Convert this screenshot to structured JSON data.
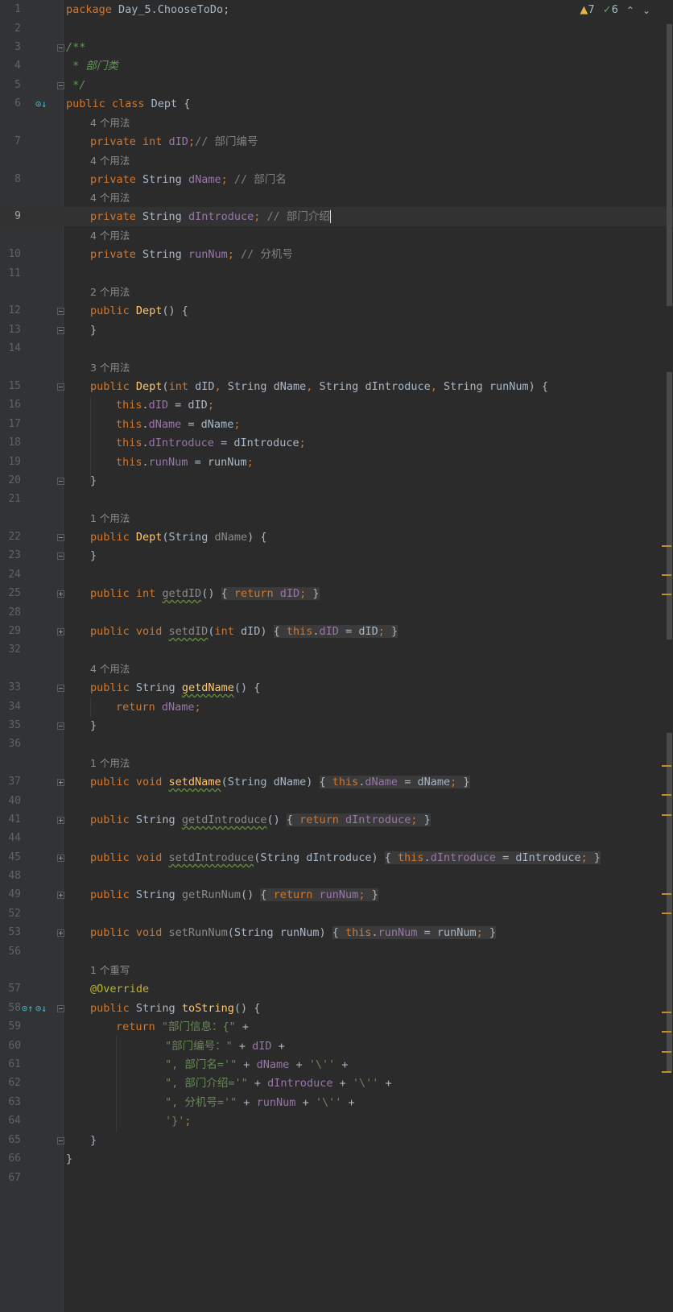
{
  "inspection": {
    "warnings": "7",
    "weak_warnings": "6"
  },
  "lines": {
    "l1": "1",
    "l2": "2",
    "l3": "3",
    "l4": "4",
    "l5": "5",
    "l6": "6",
    "l7": "7",
    "l8": "8",
    "l9": "9",
    "l10": "10",
    "l11": "11",
    "l12": "12",
    "l13": "13",
    "l14": "14",
    "l15": "15",
    "l16": "16",
    "l17": "17",
    "l18": "18",
    "l19": "19",
    "l20": "20",
    "l21": "21",
    "l22": "22",
    "l23": "23",
    "l24": "24",
    "l25": "25",
    "l28": "28",
    "l29": "29",
    "l32": "32",
    "l33": "33",
    "l34": "34",
    "l35": "35",
    "l36": "36",
    "l37": "37",
    "l40": "40",
    "l41": "41",
    "l44": "44",
    "l45": "45",
    "l48": "48",
    "l49": "49",
    "l52": "52",
    "l53": "53",
    "l56": "56",
    "l57": "57",
    "l58": "58",
    "l59": "59",
    "l60": "60",
    "l61": "61",
    "l62": "62",
    "l63": "63",
    "l64": "64",
    "l65": "65",
    "l66": "66",
    "l67": "67"
  },
  "hints": {
    "dID": "4 个用法",
    "dName": "4 个用法",
    "dIntroduce": "4 个用法",
    "runNum": "4 个用法",
    "ctor0": "2 个用法",
    "ctor4": "3 个用法",
    "ctor1": "1 个用法",
    "getdName": "4 个用法",
    "setdName": "1 个用法",
    "toString": "1 个重写"
  },
  "code": {
    "package_kw": "package",
    "package_name": " Day_5.ChooseToDo;",
    "doc_open": "/**",
    "doc_line": " * 部门类",
    "doc_close": " */",
    "c_dID": "// 部门编号",
    "c_dName": "// 部门名",
    "c_dIntroduce": "// 部门介绍",
    "c_runNum": "// 分机号",
    "s59": "\"部门信息：{\"",
    "s60": "\"部门编号：\"",
    "s61": "\", 部门名='\"",
    "s62": "\", 部门介绍='\"",
    "s63": "\", 分机号='\"",
    "q": "'\\''",
    "s64": "'}'"
  }
}
